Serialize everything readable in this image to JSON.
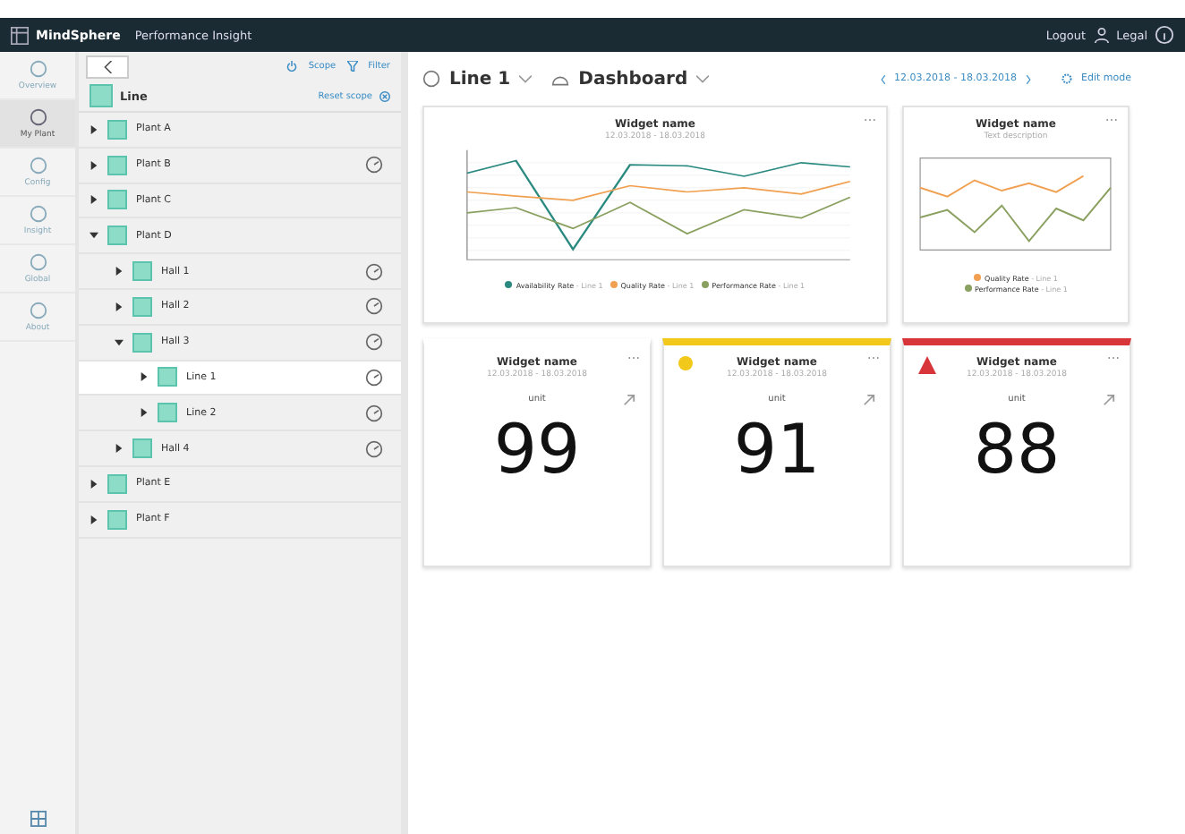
{
  "header": {
    "brand": "MindSphere",
    "app": "Performance Insight",
    "logout": "Logout",
    "legal": "Legal"
  },
  "rail": [
    {
      "label": "Overview",
      "selected": false
    },
    {
      "label": "My Plant",
      "selected": true
    },
    {
      "label": "Config",
      "selected": false
    },
    {
      "label": "Insight",
      "selected": false
    },
    {
      "label": "Global",
      "selected": false
    },
    {
      "label": "About",
      "selected": false
    }
  ],
  "tree_panel": {
    "scope": "Scope",
    "filter": "Filter",
    "root": "Line",
    "reset": "Reset scope",
    "items": [
      {
        "label": "Plant A",
        "expanded": false,
        "clock": false,
        "selected": false
      },
      {
        "label": "Plant B",
        "expanded": false,
        "clock": true,
        "selected": false
      },
      {
        "label": "Plant C",
        "expanded": false,
        "clock": false,
        "selected": false
      },
      {
        "label": "Plant D",
        "expanded": true,
        "clock": false,
        "selected": false,
        "children": [
          {
            "label": "Hall 1",
            "expanded": false,
            "clock": true,
            "selected": false
          },
          {
            "label": "Hall 2",
            "expanded": false,
            "clock": true,
            "selected": false
          },
          {
            "label": "Hall 3",
            "expanded": true,
            "clock": true,
            "selected": false,
            "children": [
              {
                "label": "Line 1",
                "expanded": false,
                "clock": true,
                "selected": true
              },
              {
                "label": "Line 2",
                "expanded": false,
                "clock": true,
                "selected": false
              }
            ]
          },
          {
            "label": "Hall 4",
            "expanded": false,
            "clock": true,
            "selected": false
          }
        ]
      },
      {
        "label": "Plant E",
        "expanded": false,
        "clock": false,
        "selected": false
      },
      {
        "label": "Plant F",
        "expanded": false,
        "clock": false,
        "selected": false
      }
    ]
  },
  "toolbar": {
    "asset": "Line 1",
    "dashboard": "Dashboard",
    "date_range": "12.03.2018 - 18.03.2018",
    "edit": "Edit mode"
  },
  "chart_widgets": [
    {
      "title": "Widget name",
      "subtitle": "12.03.2018 - 18.03.2018",
      "axes": true,
      "legend": [
        {
          "label": "Availability Rate",
          "sub": "- Line 1",
          "color": "#2a8a80"
        },
        {
          "label": "Quality Rate",
          "sub": "- Line 1",
          "color": "#f0a050"
        },
        {
          "label": "Performance Rate",
          "sub": "- Line 1",
          "color": "#8aa060"
        }
      ]
    },
    {
      "title": "Widget name",
      "subtitle": "Text description",
      "axes": false,
      "legend": [
        {
          "label": "Quality Rate",
          "sub": "- Line 1",
          "color": "#f0a050"
        },
        {
          "label": "Performance Rate",
          "sub": "- Line 1",
          "color": "#8aa060"
        }
      ]
    }
  ],
  "kpi_widgets": [
    {
      "title": "Widget name",
      "subtitle": "12.03.2018 - 18.03.2018",
      "unit": "unit",
      "value": "99",
      "warning": false,
      "error": false
    },
    {
      "title": "Widget name",
      "subtitle": "12.03.2018 - 18.03.2018",
      "unit": "unit",
      "value": "91",
      "warning": true,
      "error": false
    },
    {
      "title": "Widget name",
      "subtitle": "12.03.2018 - 18.03.2018",
      "unit": "unit",
      "value": "88",
      "warning": false,
      "error": true
    }
  ]
}
